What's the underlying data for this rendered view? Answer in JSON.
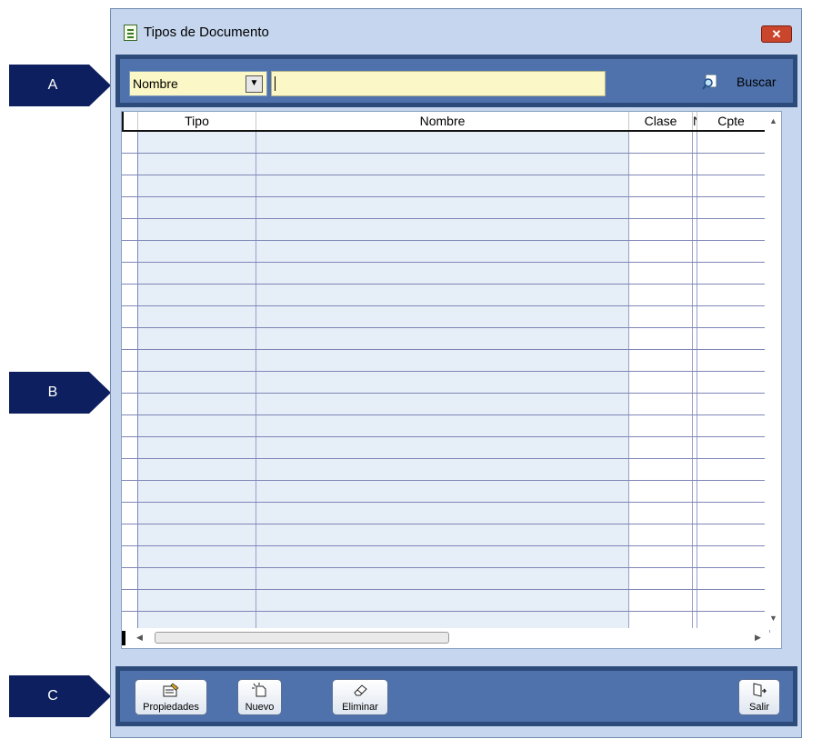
{
  "markers": [
    "A",
    "B",
    "C"
  ],
  "window": {
    "title": "Tipos de Documento",
    "close_symbol": "✕"
  },
  "search": {
    "field_value": "Nombre",
    "query": "",
    "buscar_label": "Buscar"
  },
  "grid": {
    "columns": [
      "Tipo",
      "Nombre",
      "Clase",
      "N",
      "Cpte"
    ],
    "rows": [],
    "empty_row_count": 23
  },
  "toolbar": {
    "propiedades_label": "Propiedades",
    "nuevo_label": "Nuevo",
    "eliminar_label": "Eliminar",
    "salir_label": "Salir"
  },
  "colors": {
    "marker": "#0d1f5e",
    "panel_dark": "#2c4a7a",
    "panel": "#4f72ad",
    "input_bg": "#fbf7c6",
    "grid_row_bg": "#e6eef8",
    "close": "#c9462c"
  },
  "icons": {
    "title": "document-list-icon",
    "buscar": "search-doc-icon",
    "propiedades": "properties-icon",
    "nuevo": "new-document-icon",
    "eliminar": "eraser-icon",
    "salir": "exit-door-icon"
  }
}
